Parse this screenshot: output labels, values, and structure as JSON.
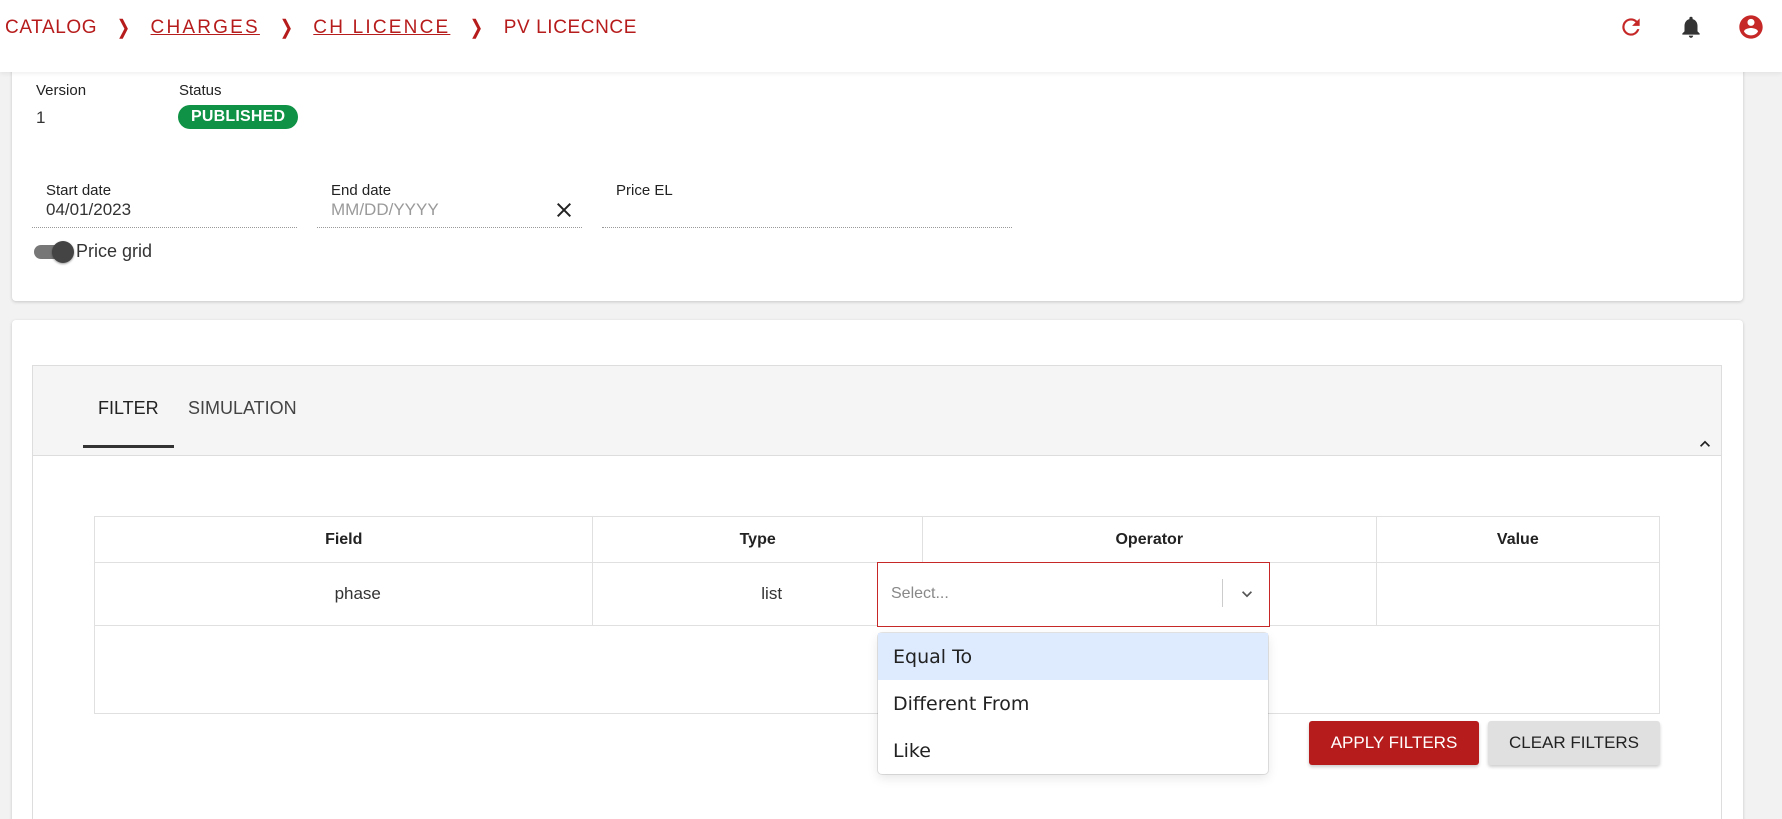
{
  "breadcrumb": {
    "items": [
      {
        "label": "CATALOG",
        "link": false
      },
      {
        "label": "CHARGES",
        "link": true
      },
      {
        "label": "CH LICENCE",
        "link": true
      },
      {
        "label": "PV LICECNCE",
        "link": false
      }
    ]
  },
  "header_icons": [
    "refresh-icon",
    "bell-icon",
    "account-icon"
  ],
  "details": {
    "version_label": "Version",
    "version_value": "1",
    "status_label": "Status",
    "status_value": "PUBLISHED",
    "start_date_label": "Start date",
    "start_date_value": "04/01/2023",
    "end_date_label": "End date",
    "end_date_placeholder": "MM/DD/YYYY",
    "price_el_label": "Price EL",
    "price_grid_label": "Price grid"
  },
  "tabs": [
    {
      "label": "FILTER",
      "active": true
    },
    {
      "label": "SIMULATION",
      "active": false
    }
  ],
  "filter_table": {
    "headers": [
      "Field",
      "Type",
      "Operator",
      "Value"
    ],
    "row": {
      "field": "phase",
      "type": "list"
    }
  },
  "operator_select": {
    "placeholder": "Select...",
    "options": [
      "Equal To",
      "Different From",
      "Like"
    ]
  },
  "buttons": {
    "apply": "APPLY FILTERS",
    "clear": "CLEAR FILTERS"
  },
  "colors": {
    "accent": "#b71c1c",
    "published": "#0f9245",
    "option_highlight": "#deebff"
  }
}
